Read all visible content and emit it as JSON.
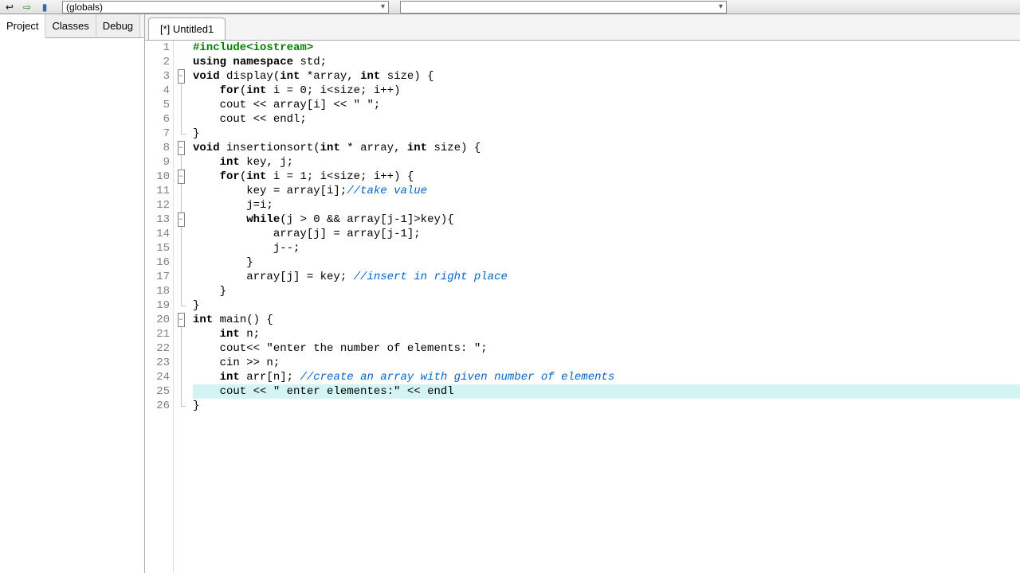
{
  "toolbar": {
    "scope_left": "(globals)",
    "scope_right": ""
  },
  "sidebar": {
    "tabs": [
      {
        "label": "Project",
        "active": true
      },
      {
        "label": "Classes",
        "active": false
      },
      {
        "label": "Debug",
        "active": false
      }
    ]
  },
  "editor": {
    "tab_label": "[*] Untitled1",
    "highlighted_line": 25,
    "code": [
      {
        "n": 1,
        "fold": "",
        "html": "<span class='preproc'>#include&lt;iostream&gt;</span>"
      },
      {
        "n": 2,
        "fold": "",
        "html": "<span class='kw'>using</span> <span class='kw'>namespace</span> std;"
      },
      {
        "n": 3,
        "fold": "box",
        "html": "<span class='kw'>void</span> display(<span class='kw'>int</span> *array, <span class='kw'>int</span> size) {"
      },
      {
        "n": 4,
        "fold": "line",
        "html": "    <span class='kw'>for</span>(<span class='kw'>int</span> i = 0; i&lt;size; i++)"
      },
      {
        "n": 5,
        "fold": "line",
        "html": "    cout &lt;&lt; array[i] &lt;&lt; <span class='str'>\" \"</span>;"
      },
      {
        "n": 6,
        "fold": "line",
        "html": "    cout &lt;&lt; endl;"
      },
      {
        "n": 7,
        "fold": "end",
        "html": "}"
      },
      {
        "n": 8,
        "fold": "box",
        "html": "<span class='kw'>void</span> insertionsort(<span class='kw'>int</span> * array, <span class='kw'>int</span> size) {"
      },
      {
        "n": 9,
        "fold": "line",
        "html": "    <span class='kw'>int</span> key, j;"
      },
      {
        "n": 10,
        "fold": "box",
        "html": "    <span class='kw'>for</span>(<span class='kw'>int</span> i = 1; i&lt;size; i++) {"
      },
      {
        "n": 11,
        "fold": "line",
        "html": "        key = array[i];<span class='cmnt'>//take value</span>"
      },
      {
        "n": 12,
        "fold": "line",
        "html": "        j=i;"
      },
      {
        "n": 13,
        "fold": "box",
        "html": "        <span class='kw'>while</span>(j &gt; 0 &amp;&amp; array[j-1]&gt;key){"
      },
      {
        "n": 14,
        "fold": "line",
        "html": "            array[j] = array[j-1];"
      },
      {
        "n": 15,
        "fold": "line",
        "html": "            j--;"
      },
      {
        "n": 16,
        "fold": "line",
        "html": "        }"
      },
      {
        "n": 17,
        "fold": "line",
        "html": "        array[j] = key; <span class='cmnt'>//insert in right place</span>"
      },
      {
        "n": 18,
        "fold": "line",
        "html": "    }"
      },
      {
        "n": 19,
        "fold": "end",
        "html": "}"
      },
      {
        "n": 20,
        "fold": "box",
        "html": "<span class='kw'>int</span> main() {"
      },
      {
        "n": 21,
        "fold": "line",
        "html": "    <span class='kw'>int</span> n;"
      },
      {
        "n": 22,
        "fold": "line",
        "html": "    cout&lt;&lt; <span class='str'>\"enter the number of elements: \"</span>;"
      },
      {
        "n": 23,
        "fold": "line",
        "html": "    cin &gt;&gt; n;"
      },
      {
        "n": 24,
        "fold": "line",
        "html": "    <span class='kw'>int</span> arr[n]; <span class='cmnt'>//create an array with given number of elements</span>"
      },
      {
        "n": 25,
        "fold": "line",
        "html": "    cout &lt;&lt; <span class='str'>\" enter elementes:\"</span> &lt;&lt; endl"
      },
      {
        "n": 26,
        "fold": "end",
        "html": "}"
      }
    ]
  }
}
